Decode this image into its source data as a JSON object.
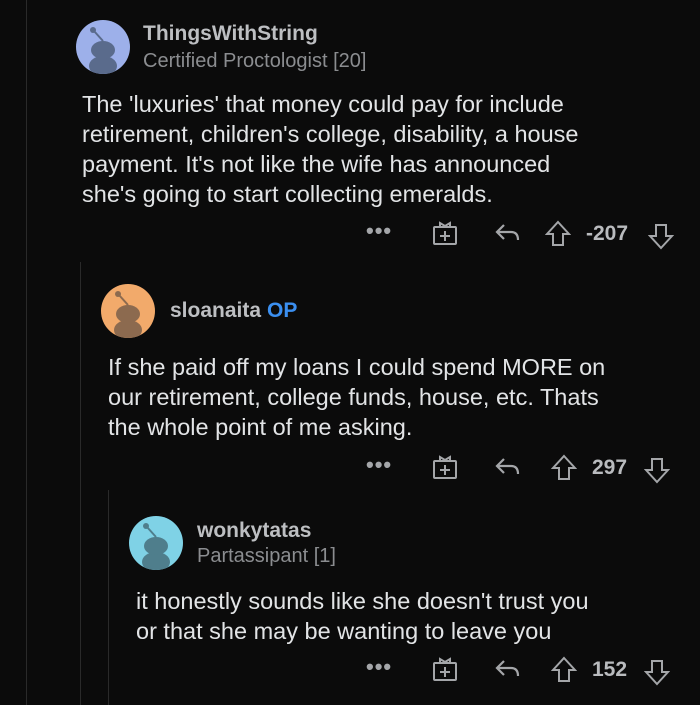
{
  "comments": [
    {
      "username": "ThingsWithString",
      "flair": "Certified Proctologist [20]",
      "avatar_color": "#9db0ea",
      "lines": [
        "The 'luxuries' that money could pay for include",
        "retirement, children's college, disability, a house",
        "payment.  It's not like the wife has announced",
        "she's going to start collecting emeralds."
      ],
      "score": "-207"
    },
    {
      "username": "sloanaita",
      "op_label": "OP",
      "avatar_color": "#f2aa6b",
      "lines": [
        "If she paid off my loans I could spend MORE on",
        "our retirement, college funds,  house, etc. Thats",
        "the whole point of me asking."
      ],
      "score": "297"
    },
    {
      "username": "wonkytatas",
      "flair": "Partassipant [1]",
      "avatar_color": "#7fd2e6",
      "lines": [
        "it honestly sounds like she doesn't trust you",
        "or that she may be wanting to leave you"
      ],
      "score": "152"
    }
  ],
  "actions": {
    "more": "•••"
  },
  "icons": [
    "more-icon",
    "award-icon",
    "reply-icon",
    "upvote-icon",
    "downvote-icon",
    "snoo-avatar-icon"
  ]
}
